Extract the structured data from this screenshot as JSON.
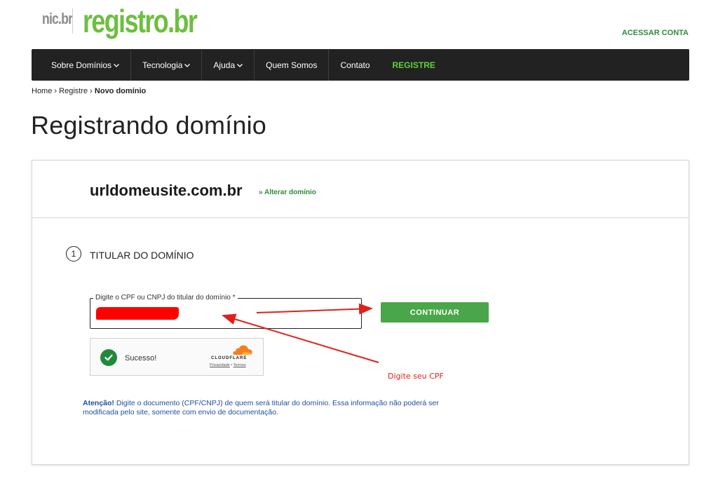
{
  "header": {
    "logo_nic": "nic.br",
    "logo_registro": "registro.br",
    "account_link": "ACESSAR CONTA"
  },
  "nav": {
    "items": [
      {
        "label": "Sobre Domínios",
        "dropdown": true
      },
      {
        "label": "Tecnologia",
        "dropdown": true
      },
      {
        "label": "Ajuda",
        "dropdown": true
      },
      {
        "label": "Quem Somos",
        "dropdown": false
      },
      {
        "label": "Contato",
        "dropdown": false
      },
      {
        "label": "REGISTRE",
        "dropdown": false
      }
    ],
    "highlight_color": "#5fd23a"
  },
  "breadcrumb": {
    "home": "Home",
    "registre": "Registre",
    "current": "Novo domínio",
    "separator": "›"
  },
  "page": {
    "title": "Registrando domínio"
  },
  "card": {
    "domain": "urldomeusite.com.br",
    "change_link": "» Alterar domínio",
    "step": {
      "number": "1",
      "title": "TITULAR DO DOMÍNIO"
    },
    "field": {
      "label": "Digite o CPF ou CNPJ do titular do domínio *",
      "value_redacted": true
    },
    "continue_button": "CONTINUAR",
    "captcha": {
      "status": "Sucesso!",
      "provider": "CLOUDFLARE",
      "privacy": "Privacidade",
      "separator": "•",
      "terms": "Termos"
    },
    "attention_label": "Atenção!",
    "attention_text": "Digite o documento (CPF/CNPJ) de quem será titular do domínio. Essa informação não poderá ser modificada pelo site, somente com envio de documentação."
  },
  "annotation": {
    "hint": "Digite seu CPF",
    "color": "#e0201c"
  },
  "colors": {
    "brand_green": "#6dbf3f",
    "button_green": "#4aa64a",
    "link_green": "#2e8b3a",
    "nav_bg": "#222222",
    "attention_blue": "#1f4fa0"
  },
  "icons": {
    "dropdown": "chevron-down-icon",
    "captcha_ok": "check-circle-icon",
    "cloudflare": "cloud-icon"
  }
}
